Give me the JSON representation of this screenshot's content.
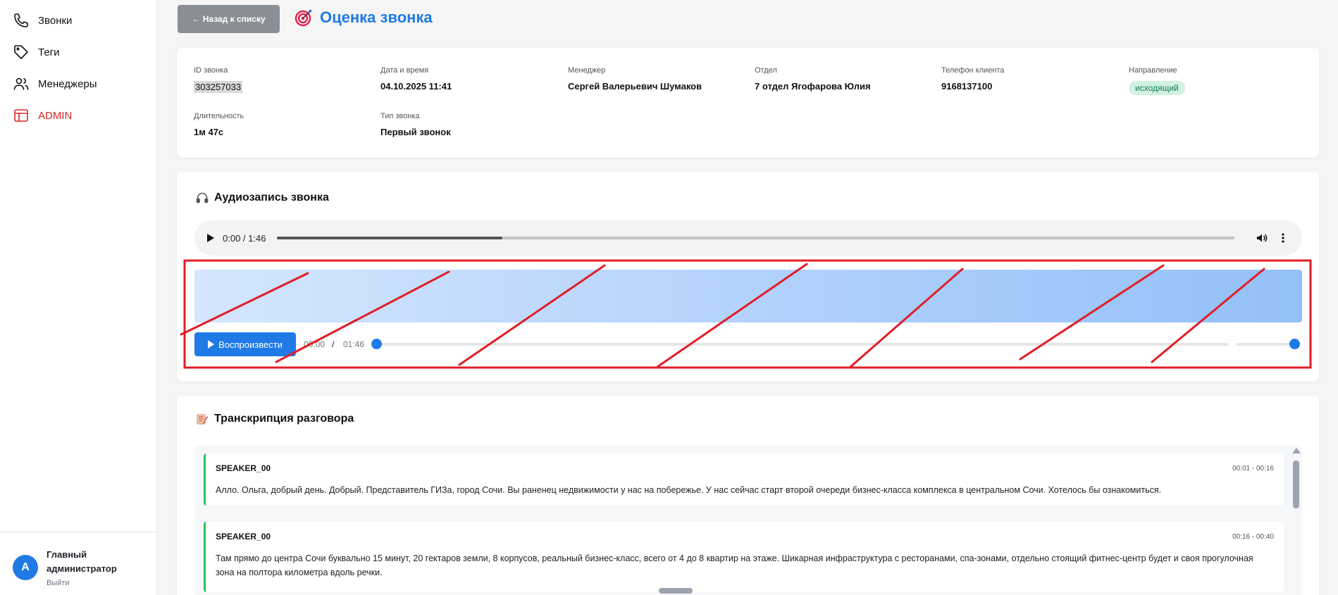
{
  "sidebar": {
    "items": [
      {
        "label": "Звонки",
        "icon": "phone-icon"
      },
      {
        "label": "Теги",
        "icon": "tag-icon"
      },
      {
        "label": "Менеджеры",
        "icon": "users-icon"
      },
      {
        "label": "ADMIN",
        "icon": "admin-icon"
      }
    ],
    "user": {
      "initial": "A",
      "name": "Главный администратор",
      "logout": "Выйти"
    }
  },
  "header": {
    "back_label": "← Назад к списку",
    "title": "Оценка звонка"
  },
  "info": {
    "call_id": {
      "label": "ID звонка",
      "value": "303257033"
    },
    "datetime": {
      "label": "Дата и время",
      "value": "04.10.2025 11:41"
    },
    "manager": {
      "label": "Менеджер",
      "value": "Сергей Валерьевич Шумаков"
    },
    "department": {
      "label": "Отдел",
      "value": "7 отдел Ягофарова Юлия"
    },
    "phone": {
      "label": "Телефон клиента",
      "value": "9168137100"
    },
    "direction": {
      "label": "Направление",
      "value": "исходящий"
    },
    "duration": {
      "label": "Длительность",
      "value": "1м 47с"
    },
    "call_type": {
      "label": "Тип звонка",
      "value": "Первый звонок"
    }
  },
  "audio": {
    "title": "Аудиозапись звонка",
    "player_time": "0:00 / 1:46",
    "buffered_fraction": 0.235,
    "play_label": "Воспроизвести",
    "current": "00:00",
    "separator": "/",
    "total": "01:46",
    "seek_fraction": 0.0,
    "volume_fraction": 1.0
  },
  "transcript": {
    "title": "Транскрипция разговора",
    "segments": [
      {
        "speaker": "SPEAKER_00",
        "range": "00:01 - 00:16",
        "text": "Алло. Ольга, добрый день. Добрый. Представитель ГИЗа, город Сочи. Вы раненец недвижимости у нас на побережье. У нас сейчас старт второй очереди бизнес-класса комплекса в центральном Сочи. Хотелось бы ознакомиться."
      },
      {
        "speaker": "SPEAKER_00",
        "range": "00:16 - 00:40",
        "text": "Там прямо до центра Сочи буквально 15 минут, 20 гектаров земли, 8 корпусов, реальный бизнес-класс, всего от 4 до 8 квартир на этаже. Шикарная инфраструктура с ресторанами, спа-зонами, отдельно стоящий фитнес-центр будет и своя прогулочная зона на полтора километра вдоль речки."
      }
    ]
  },
  "colors": {
    "accent": "#1f7ae6",
    "admin": "#dc2626",
    "annotation": "#e11d26",
    "speaker_bar": "#22c55e"
  }
}
